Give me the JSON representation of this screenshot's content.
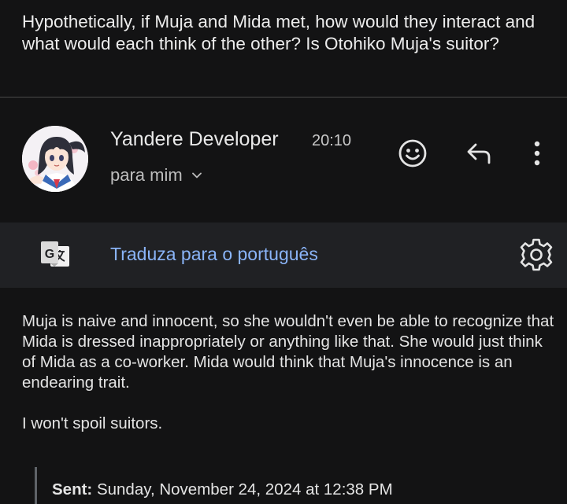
{
  "question": "Hypothetically, if Muja and Mida met, how would they interact and what would each think of the other? Is Otohiko Muja's suitor?",
  "header": {
    "sender_name": "Yandere Developer",
    "time": "20:10",
    "recipient": "para mim",
    "icons": {
      "emoji": "smiley-face-icon",
      "reply": "reply-arrow-icon",
      "more": "more-vertical-icon",
      "expand": "chevron-down-icon"
    }
  },
  "translate": {
    "link_label": "Traduza para o português",
    "icons": {
      "translate": "google-translate-icon",
      "settings": "gear-icon"
    }
  },
  "body": {
    "paragraph1": "Muja is naive and innocent, so she wouldn't even be able to recognize that Mida is dressed inappropriately or anything like that. She would just think of Mida as a co-worker. Mida would think that Muja's innocence is an endearing trait.",
    "paragraph2": "I won't spoil suitors."
  },
  "quoted": {
    "sent_label": "Sent:",
    "sent_value": "Sunday, November 24, 2024 at 12:38 PM"
  },
  "colors": {
    "background": "#131314",
    "translate_bar": "#202124",
    "link": "#8ab4f8",
    "text": "#e8e8e8"
  }
}
